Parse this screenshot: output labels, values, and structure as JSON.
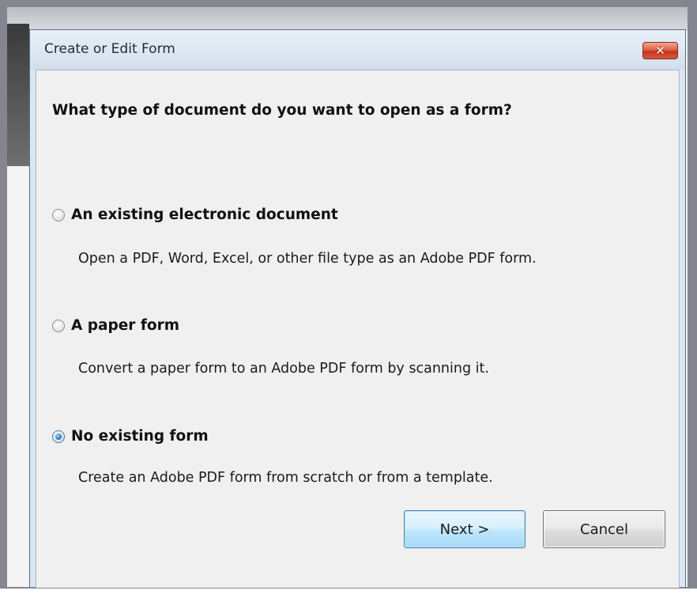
{
  "dialog": {
    "title": "Create or Edit Form",
    "close_glyph": "✕",
    "question": "What type of document do you want to open as a form?"
  },
  "options": [
    {
      "label": "An existing electronic document",
      "description": "Open a PDF, Word, Excel, or other file type as an Adobe PDF form.",
      "selected": false
    },
    {
      "label": "A paper form",
      "description": "Convert a paper form to an Adobe PDF form by scanning it.",
      "selected": false
    },
    {
      "label": "No existing form",
      "description": "Create an Adobe PDF form from scratch or from a template.",
      "selected": true
    }
  ],
  "buttons": {
    "next_label": "Next >",
    "cancel_label": "Cancel"
  },
  "colors": {
    "close_button": "#d8583c",
    "next_button_border": "#3c7fb1",
    "selected_radio": "#2f82c8"
  }
}
